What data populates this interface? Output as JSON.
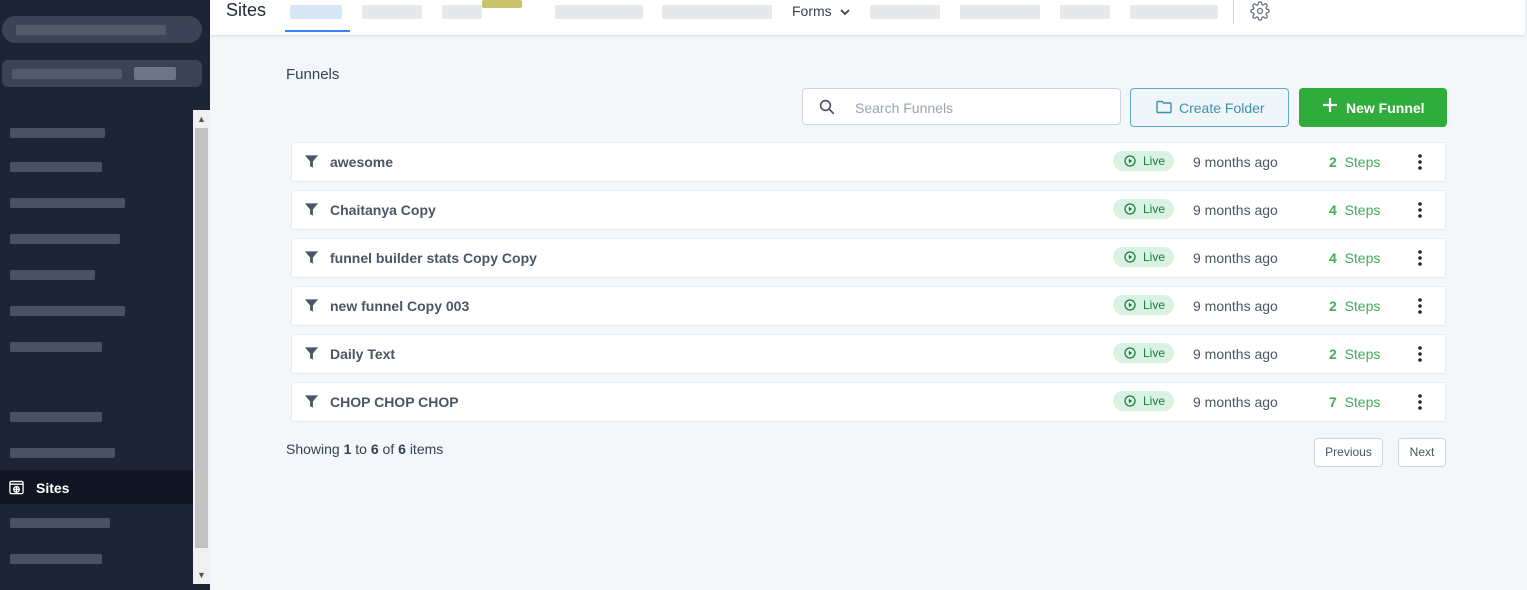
{
  "app": {
    "section_title": "Sites",
    "active_sidebar_label": "Sites"
  },
  "topnav": {
    "forms_label": "Forms"
  },
  "main": {
    "heading": "Funnels",
    "search_placeholder": "Search Funnels",
    "create_folder_label": "Create Folder",
    "new_funnel_label": "New Funnel",
    "status_label": "Live",
    "steps_word": "Steps",
    "funnels": [
      {
        "name": "awesome",
        "time": "9 months ago",
        "steps": "2"
      },
      {
        "name": "Chaitanya Copy",
        "time": "9 months ago",
        "steps": "4"
      },
      {
        "name": "funnel builder stats Copy Copy",
        "time": "9 months ago",
        "steps": "4"
      },
      {
        "name": "new funnel Copy 003",
        "time": "9 months ago",
        "steps": "2"
      },
      {
        "name": "Daily Text",
        "time": "9 months ago",
        "steps": "2"
      },
      {
        "name": "CHOP CHOP CHOP",
        "time": "9 months ago",
        "steps": "7"
      }
    ],
    "pagination": {
      "showing_prefix": "Showing",
      "from": "1",
      "to_word": "to",
      "to": "6",
      "of_word": "of",
      "total": "6",
      "items_word": "items",
      "previous_label": "Previous",
      "next_label": "Next"
    }
  },
  "colors": {
    "sidebar_bg": "#1d2433",
    "accent_green": "#2fac3c",
    "folder_blue": "#3e8eb0",
    "live_bg": "#d9f2e3",
    "steps_green": "#3fae56"
  },
  "icons": {
    "funnel": "funnel-icon",
    "search": "search-icon",
    "folder": "folder-icon",
    "plus": "plus-icon",
    "live": "play-circle-icon",
    "menu": "kebab-icon",
    "settings": "gear-icon",
    "sites": "globe-window-icon"
  }
}
